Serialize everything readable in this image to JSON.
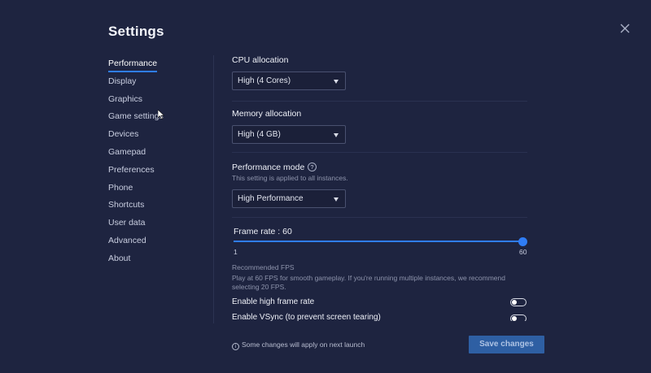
{
  "dialog": {
    "title": "Settings",
    "close_icon": "close-icon"
  },
  "sidebar": {
    "items": [
      {
        "label": "Performance",
        "active": true
      },
      {
        "label": "Display"
      },
      {
        "label": "Graphics"
      },
      {
        "label": "Game settings"
      },
      {
        "label": "Devices"
      },
      {
        "label": "Gamepad"
      },
      {
        "label": "Preferences"
      },
      {
        "label": "Phone"
      },
      {
        "label": "Shortcuts"
      },
      {
        "label": "User data"
      },
      {
        "label": "Advanced"
      },
      {
        "label": "About"
      }
    ]
  },
  "performance": {
    "cpu": {
      "label": "CPU allocation",
      "value": "High (4 Cores)"
    },
    "memory": {
      "label": "Memory allocation",
      "value": "High (4 GB)"
    },
    "mode": {
      "label": "Performance mode",
      "help_glyph": "?",
      "note": "This setting is applied to all instances.",
      "value": "High Performance"
    },
    "frame_rate": {
      "label": "Frame rate : 60",
      "min_label": "1",
      "max_label": "60",
      "value": 60,
      "min": 1,
      "max": 60,
      "recommended_label": "Recommended FPS",
      "recommended_text": "Play at 60 FPS for smooth gameplay. If you're running multiple instances, we recommend selecting 20 FPS."
    },
    "toggles": [
      {
        "label": "Enable high frame rate",
        "on": false
      },
      {
        "label": "Enable VSync (to prevent screen tearing)",
        "on": false
      }
    ]
  },
  "footer": {
    "info_glyph": "i",
    "note": "Some changes will apply on next launch",
    "save_label": "Save changes"
  },
  "colors": {
    "background": "#1e2440",
    "accent": "#2f7df6",
    "save_button": "#2e5fa3"
  }
}
